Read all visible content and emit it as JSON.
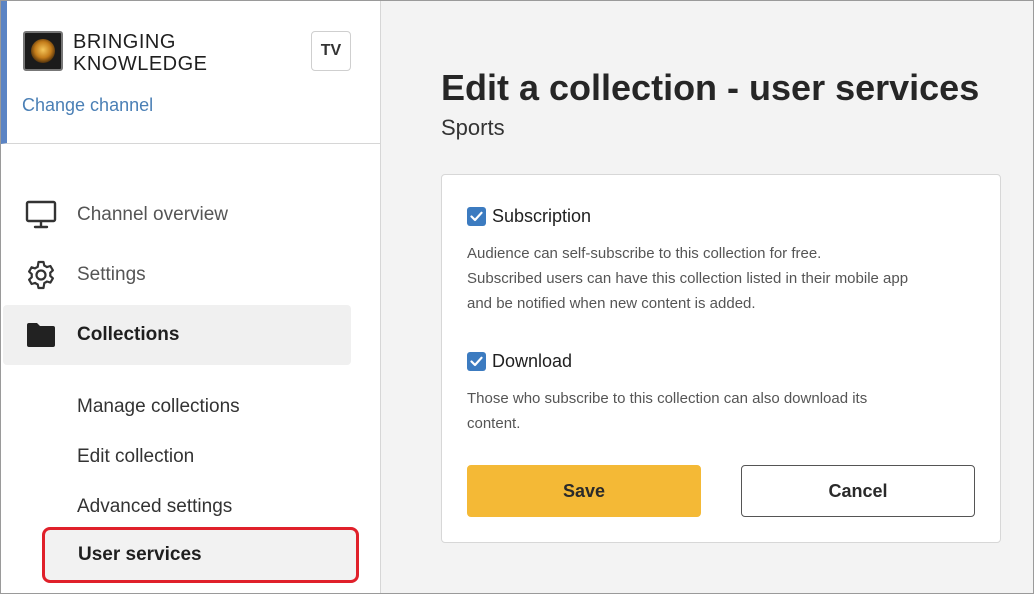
{
  "sidebar": {
    "channel": {
      "name_line1": "BRINGING",
      "name_line2": "KNOWLEDGE",
      "badge": "TV",
      "change_link": "Change channel"
    },
    "nav": [
      {
        "label": "Channel overview",
        "icon": "monitor-icon"
      },
      {
        "label": "Settings",
        "icon": "gear-icon"
      },
      {
        "label": "Collections",
        "icon": "folder-icon",
        "active": true
      }
    ],
    "subnav": [
      {
        "label": "Manage collections"
      },
      {
        "label": "Edit collection"
      },
      {
        "label": "Advanced settings"
      },
      {
        "label": "User services",
        "active": true
      }
    ]
  },
  "main": {
    "title": "Edit a collection - user services",
    "subtitle": "Sports",
    "options": [
      {
        "label": "Subscription",
        "checked": true,
        "description_lines": [
          "Audience can self-subscribe to this collection for free.",
          "Subscribed users can have this collection listed in their mobile app",
          "and be notified when new content is added."
        ]
      },
      {
        "label": "Download",
        "checked": true,
        "description_lines": [
          "Those who subscribe to this collection can also download its",
          "content."
        ]
      }
    ],
    "save_label": "Save",
    "cancel_label": "Cancel"
  },
  "colors": {
    "accent_blue": "#3c7bc0",
    "link_blue": "#4a7fb5",
    "save_yellow": "#f4b936",
    "highlight_red": "#e0202a",
    "sidebar_stripe": "#5b84c4"
  }
}
